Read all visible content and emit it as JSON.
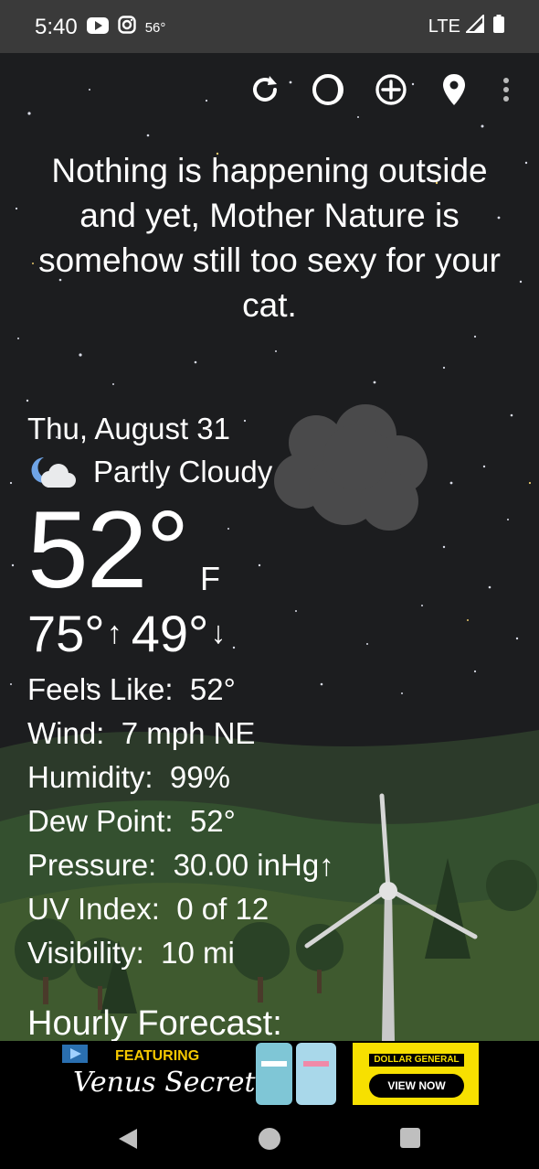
{
  "status_bar": {
    "time": "5:40",
    "temperature": "56°",
    "network": "LTE"
  },
  "toolbar": {
    "refresh_icon": "refresh-icon",
    "moon_icon": "moon-phase-icon",
    "add_icon": "add-location-icon",
    "location_icon": "location-pin-icon",
    "menu_icon": "more-vert-icon"
  },
  "quote": "Nothing is happening outside and yet, Mother Nature is somehow still too sexy for your cat.",
  "weather": {
    "date": "Thu, August 31",
    "condition": "Partly Cloudy",
    "temperature": "52°",
    "unit": "F",
    "high": "75°",
    "low": "49°",
    "details": [
      {
        "label": "Feels Like:",
        "value": "52°"
      },
      {
        "label": "Wind:",
        "value": "7 mph NE"
      },
      {
        "label": "Humidity:",
        "value": "99%"
      },
      {
        "label": "Dew Point:",
        "value": "52°"
      },
      {
        "label": "Pressure:",
        "value": "30.00 inHg↑"
      },
      {
        "label": "UV Index:",
        "value": "0 of 12"
      },
      {
        "label": "Visibility:",
        "value": "10 mi"
      }
    ],
    "hourly_title": "Hourly Forecast:"
  },
  "ad": {
    "featuring": "FEATURING",
    "brand": "Venus Secret",
    "sponsor": "DOLLAR GENERAL",
    "cta": "VIEW NOW"
  },
  "colors": {
    "background": "#1c1d1f",
    "status_bar": "#3a3a3a",
    "ad_yellow": "#f7e000",
    "grass": "#3f5a2f"
  }
}
